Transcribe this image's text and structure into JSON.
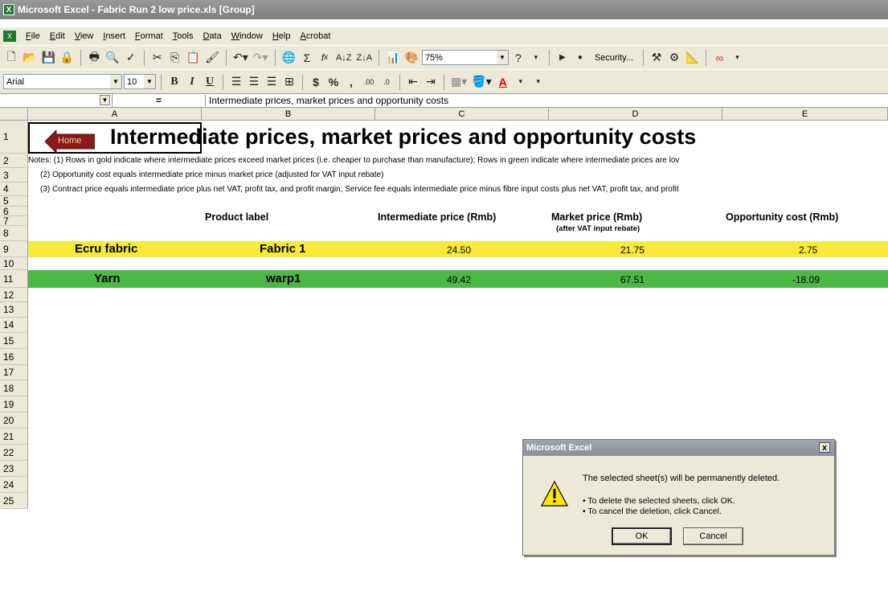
{
  "window": {
    "title": "Microsoft Excel - Fabric Run 2 low price.xls  [Group]"
  },
  "menu": [
    "File",
    "Edit",
    "View",
    "Insert",
    "Format",
    "Tools",
    "Data",
    "Window",
    "Help",
    "Acrobat"
  ],
  "toolbar": {
    "zoom": "75%",
    "security_label": "Security...",
    "font_name": "Arial",
    "font_size": "10"
  },
  "formula_bar": {
    "equals": "=",
    "content": "Intermediate prices, market prices and opportunity costs"
  },
  "columns": [
    "A",
    "B",
    "C",
    "D",
    "E"
  ],
  "rows": [
    "1",
    "2",
    "3",
    "4",
    "5",
    "6",
    "7",
    "8",
    "9",
    "10",
    "11",
    "12",
    "13",
    "14",
    "15",
    "16",
    "17",
    "18",
    "19",
    "20",
    "21",
    "22",
    "23",
    "24",
    "25"
  ],
  "sheet": {
    "home_label": "Home",
    "title": "Intermediate prices, market prices and opportunity costs",
    "notes": [
      "Notes: (1) Rows in gold indicate where intermediate prices exceed market prices (i.e. cheaper to purchase than manufacture); Rows in green indicate where intermediate prices are lov",
      "(2) Opportunity cost equals intermediate price minus market price (adjusted for VAT input rebate)",
      "(3) Contract price equals intermediate price plus net VAT, profit tax, and profit margin; Service fee equals intermediate price minus fibre input costs plus net VAT, profit tax, and profit"
    ],
    "headers": {
      "product_label": "Product label",
      "intermediate_price": "Intermediate price (Rmb)",
      "market_price": "Market price (Rmb)",
      "market_price_sub": "(after VAT input rebate)",
      "opportunity_cost": "Opportunity cost (Rmb)"
    },
    "data_rows": [
      {
        "name": "Ecru fabric",
        "label": "Fabric 1",
        "intermediate": "24.50",
        "market": "21.75",
        "opportunity": "2.75",
        "color": "#f7ea3a"
      },
      {
        "name": "Yarn",
        "label": "warp1",
        "intermediate": "49.42",
        "market": "67.51",
        "opportunity": "-18.09",
        "color": "#4cb848"
      }
    ]
  },
  "dialog": {
    "title": "Microsoft Excel",
    "close": "x",
    "message": "The selected sheet(s) will be permanently deleted.",
    "bullet_ok": "• To delete the selected sheets, click OK.",
    "bullet_cancel": "• To cancel the deletion, click Cancel.",
    "ok_label": "OK",
    "cancel_label": "Cancel"
  }
}
